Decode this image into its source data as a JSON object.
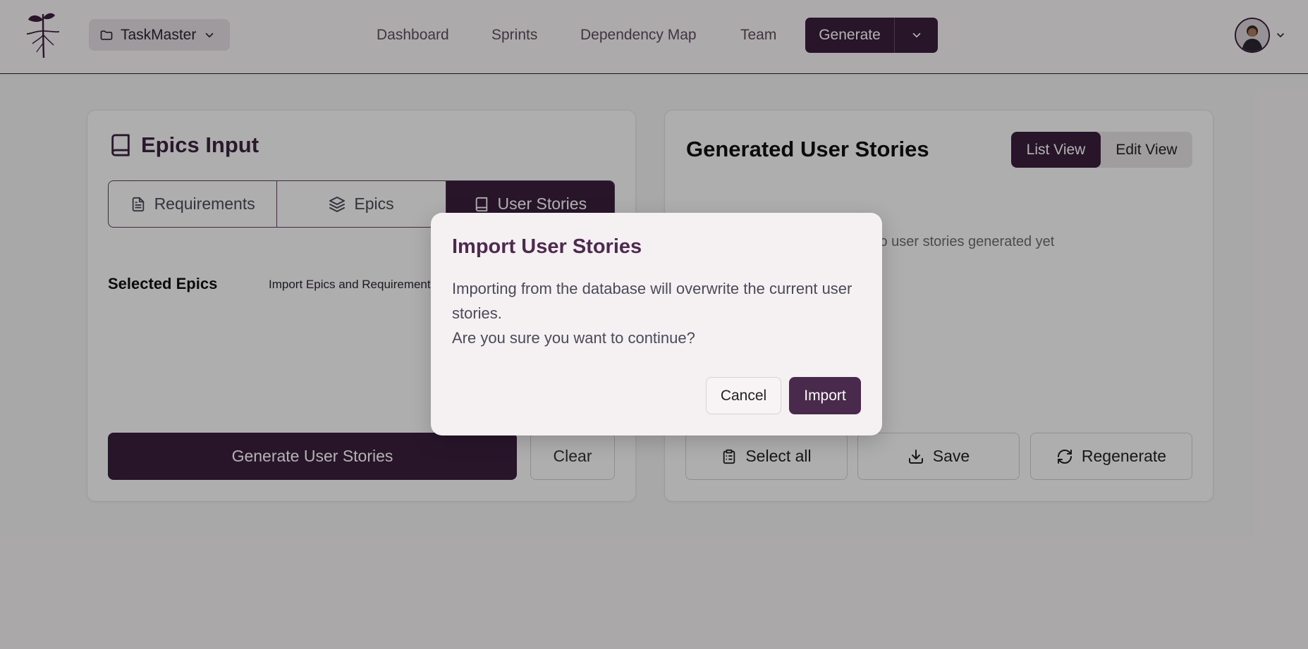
{
  "header": {
    "project_name": "TaskMaster",
    "nav": {
      "dashboard": "Dashboard",
      "sprints": "Sprints",
      "dependency_map": "Dependency Map",
      "team": "Team"
    },
    "generate_label": "Generate"
  },
  "left_card": {
    "title": "Epics Input",
    "tabs": {
      "requirements": "Requirements",
      "epics": "Epics",
      "user_stories": "User Stories"
    },
    "active_tab": "User Stories",
    "selected_epics_label": "Selected Epics",
    "import_link": "Import Epics and Requirements",
    "generate_button": "Generate User Stories",
    "clear_button": "Clear"
  },
  "right_card": {
    "title": "Generated User Stories",
    "view_toggle": {
      "list": "List View",
      "edit": "Edit View"
    },
    "active_view": "List View",
    "empty_message": "No user stories generated yet",
    "actions": {
      "select_all": "Select all",
      "save": "Save",
      "regenerate": "Regenerate"
    }
  },
  "dialog": {
    "title": "Import User Stories",
    "body_line1": "Importing from the database will overwrite the current user stories.",
    "body_line2": "Are you sure you want to continue?",
    "cancel": "Cancel",
    "import": "Import"
  },
  "colors": {
    "brand": "#3a1f3d",
    "dialog_title": "#4d2a4e",
    "overlay": "rgba(0,0,0,0.30)"
  },
  "icons": {
    "logo": "sprout-logo-icon",
    "project": "folder-icon",
    "caret": "chevron-down-icon",
    "epics_title": "book-icon",
    "requirements_tab": "file-text-icon",
    "epics_tab": "layers-icon",
    "user_stories_tab": "book-icon",
    "select_all": "clipboard-list-icon",
    "save": "download-icon",
    "regenerate": "refresh-icon"
  }
}
